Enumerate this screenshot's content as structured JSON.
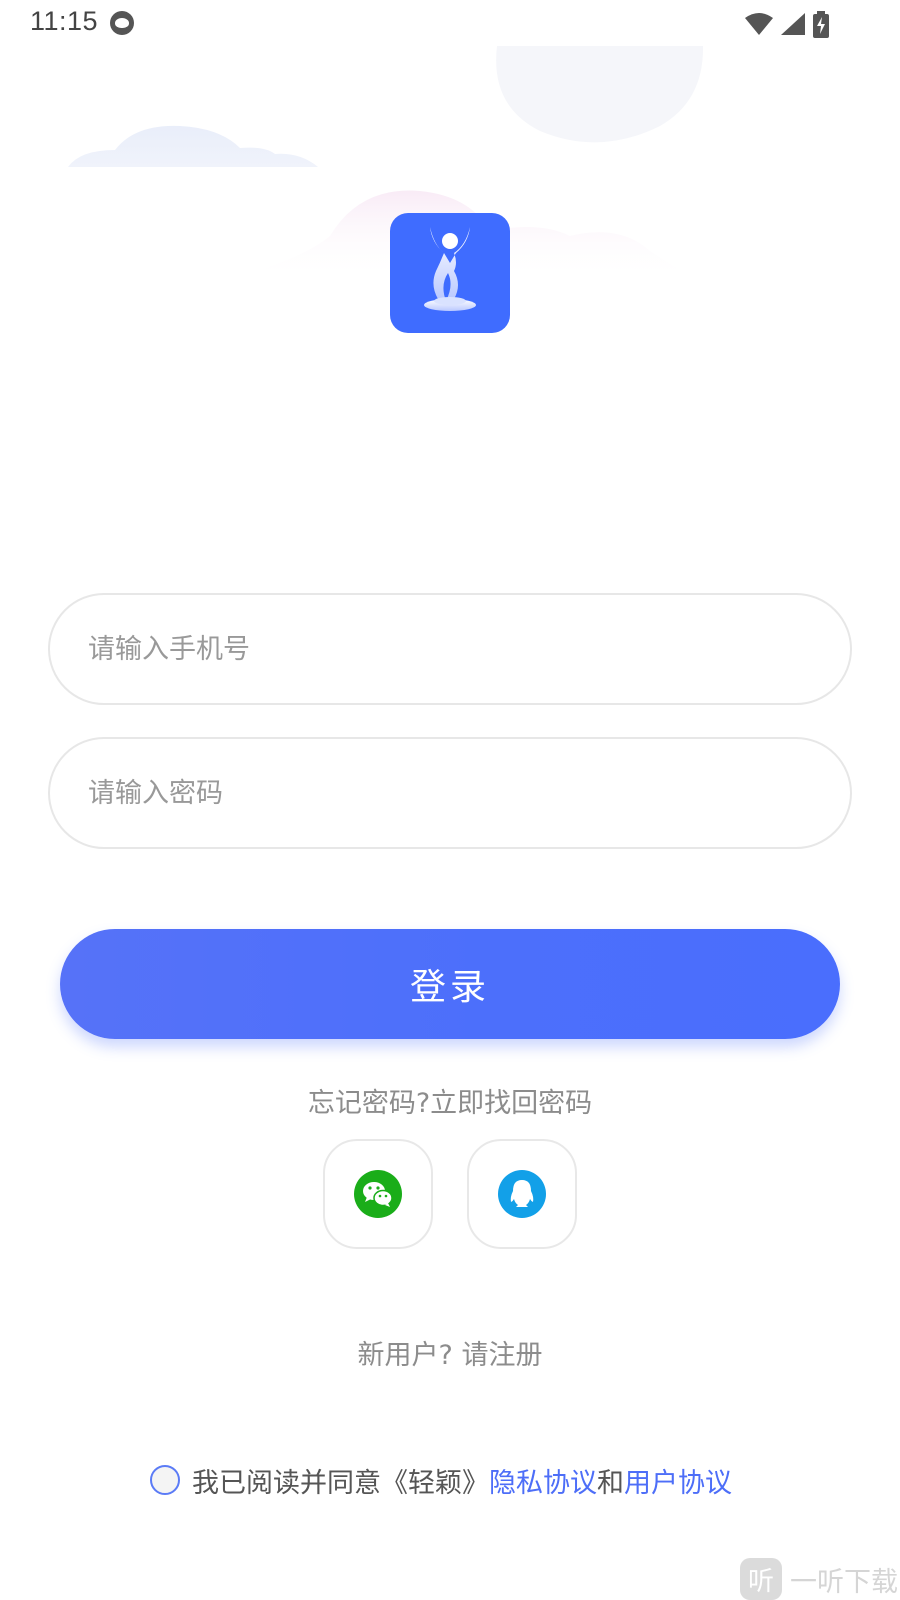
{
  "status_bar": {
    "time": "11:15"
  },
  "form": {
    "phone_placeholder": "请输入手机号",
    "password_placeholder": "请输入密码",
    "login_label": "登录",
    "forgot_link": "忘记密码?立即找回密码",
    "register_link": "新用户? 请注册"
  },
  "social": [
    {
      "name": "wechat",
      "icon": "wechat-icon",
      "color": "#1aad19"
    },
    {
      "name": "qq",
      "icon": "qq-icon",
      "color": "#12a0e8"
    }
  ],
  "agreement": {
    "prefix": "我已阅读并同意《轻颖》",
    "privacy_link": "隐私协议",
    "conjunction": "和",
    "user_link": "用户协议"
  },
  "watermark": {
    "mark": "听",
    "text": "一听下载"
  },
  "colors": {
    "primary": "#4a6efd",
    "logo_bg": "#3f6cff",
    "link": "#4d6ef8",
    "muted_text": "#8c8c8c"
  }
}
